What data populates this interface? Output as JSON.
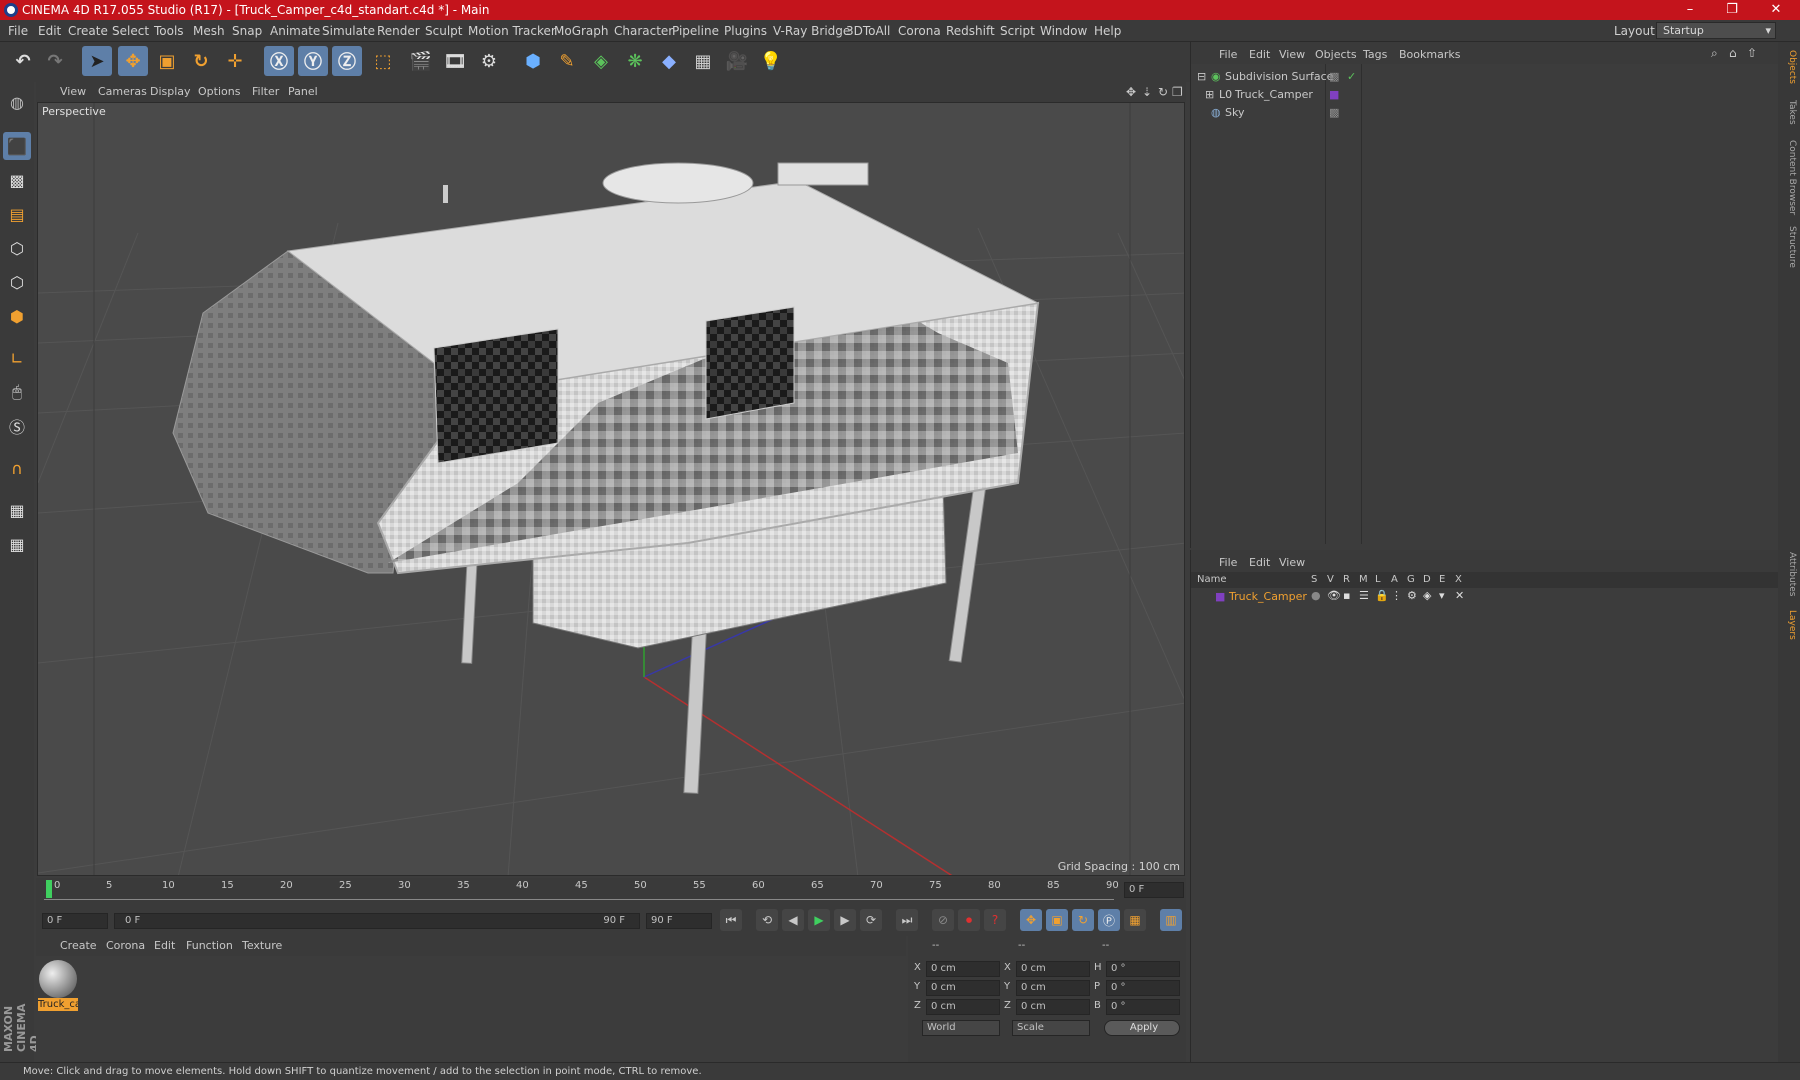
{
  "window": {
    "title": "CINEMA 4D R17.055 Studio (R17) - [Truck_Camper_c4d_standart.c4d *] - Main",
    "controls": [
      "–",
      "❐",
      "✕"
    ]
  },
  "menubar": {
    "items": [
      "File",
      "Edit",
      "Create",
      "Select",
      "Tools",
      "Mesh",
      "Snap",
      "Animate",
      "Simulate",
      "Render",
      "Sculpt",
      "Motion Tracker",
      "MoGraph",
      "Character",
      "Pipeline",
      "Plugins",
      "V-Ray Bridge",
      "3DToAll",
      "Corona",
      "Redshift",
      "Script",
      "Window",
      "Help"
    ],
    "layout_label": "Layout:",
    "layout_value": "Startup"
  },
  "viewport": {
    "menu": [
      "View",
      "Cameras",
      "Display",
      "Options",
      "Filter",
      "Panel"
    ],
    "label": "Perspective",
    "grid_spacing": "Grid Spacing : 100 cm"
  },
  "timeline": {
    "ticks": [
      "0",
      "5",
      "10",
      "15",
      "20",
      "25",
      "30",
      "35",
      "40",
      "45",
      "50",
      "55",
      "60",
      "65",
      "70",
      "75",
      "80",
      "85",
      "90"
    ],
    "frame_field": "0 F",
    "start_field": "0 F",
    "range_start": "0 F",
    "range_end": "90 F",
    "end_field": "90 F"
  },
  "material_manager": {
    "menu": [
      "Create",
      "Corona",
      "Edit",
      "Function",
      "Texture"
    ],
    "material_label": "Truck_ca"
  },
  "coordinates": {
    "headers": [
      "--",
      "--",
      "--"
    ],
    "rows": [
      {
        "a": "X",
        "av": "0 cm",
        "b": "X",
        "bv": "0 cm",
        "c": "H",
        "cv": "0 °"
      },
      {
        "a": "Y",
        "av": "0 cm",
        "b": "Y",
        "bv": "0 cm",
        "c": "P",
        "cv": "0 °"
      },
      {
        "a": "Z",
        "av": "0 cm",
        "b": "Z",
        "bv": "0 cm",
        "c": "B",
        "cv": "0 °"
      }
    ],
    "world": "World",
    "scale": "Scale",
    "apply": "Apply"
  },
  "object_manager": {
    "menu": [
      "File",
      "Edit",
      "View",
      "Objects",
      "Tags",
      "Bookmarks"
    ],
    "objects": [
      {
        "name": "Subdivision Surface",
        "color": "#5cc35c"
      },
      {
        "name": "Truck_Camper",
        "color": "#b0b0b0"
      },
      {
        "name": "Sky",
        "color": "#8ab0d8"
      }
    ]
  },
  "layer_manager": {
    "menu": [
      "File",
      "Edit",
      "View"
    ],
    "columns": [
      "Name",
      "S",
      "V",
      "R",
      "M",
      "L",
      "A",
      "G",
      "D",
      "E",
      "X"
    ],
    "layer_name": "Truck_Camper",
    "layer_color": "#f0a030"
  },
  "side_tabs": [
    "Objects",
    "Takes",
    "Content Browser",
    "Structure",
    "Attributes",
    "Layers"
  ],
  "status": "Move: Click and drag to move elements. Hold down SHIFT to quantize movement / add to the selection in point mode, CTRL to remove.",
  "branding": "MAXON CINEMA 4D",
  "colors": {
    "title_bar": "#c4141c",
    "accent": "#f0a030",
    "selected_tool": "#5e7fa8"
  }
}
